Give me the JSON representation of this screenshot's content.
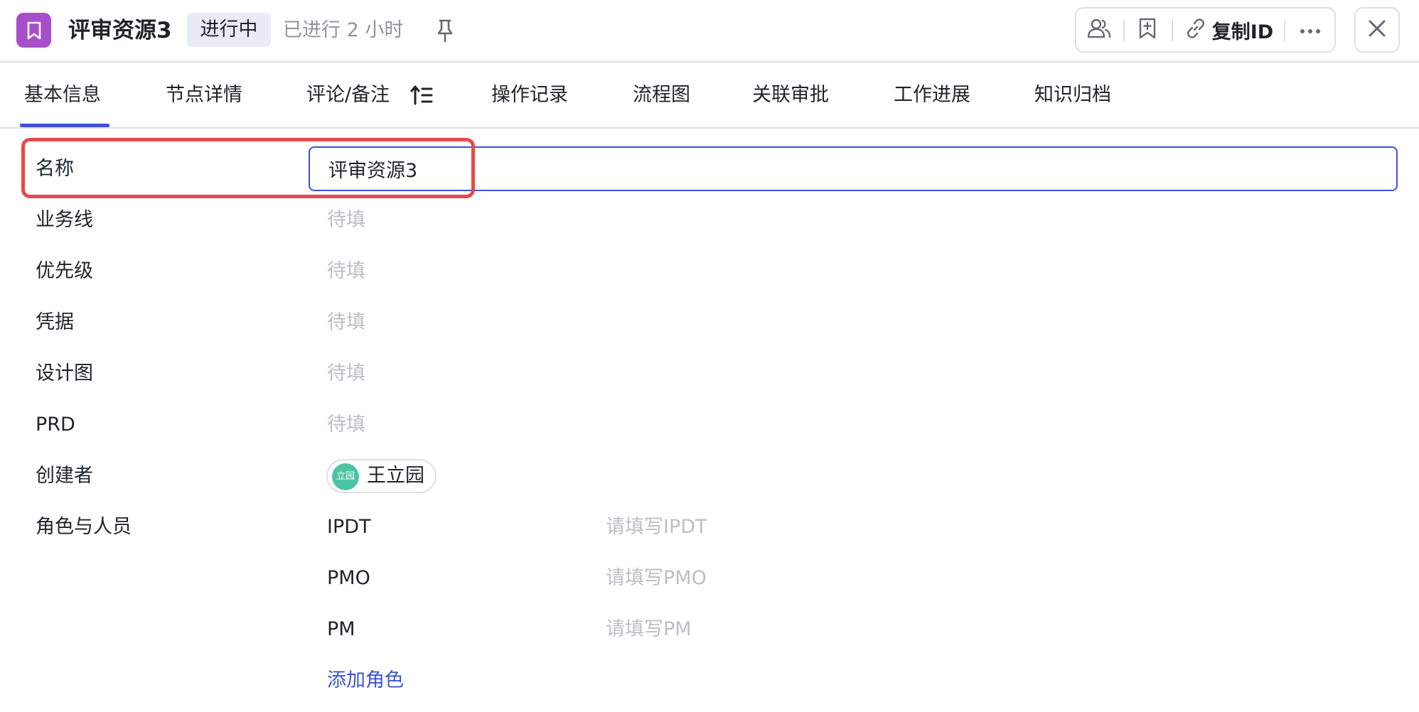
{
  "header": {
    "title": "评审资源3",
    "status": "进行中",
    "elapsed": "已进行 2 小时",
    "copy_id_label": "复制ID"
  },
  "colors": {
    "brand_icon": "#a74fca",
    "accent": "#3c53d6",
    "highlight": "#e84a4a",
    "avatar": "#4cc4a4"
  },
  "icons": [
    "bookmark-icon",
    "pin-icon",
    "people-icon",
    "bookmark-add-icon",
    "link-icon",
    "more-icon",
    "close-icon",
    "sort-icon"
  ],
  "tabs": [
    {
      "label": "基本信息",
      "active": true
    },
    {
      "label": "节点详情"
    },
    {
      "label": "评论/备注"
    },
    {
      "label": "操作记录"
    },
    {
      "label": "流程图"
    },
    {
      "label": "关联审批"
    },
    {
      "label": "工作进展"
    },
    {
      "label": "知识归档"
    }
  ],
  "form": {
    "name": {
      "label": "名称",
      "value": "评审资源3"
    },
    "business_line": {
      "label": "业务线",
      "placeholder": "待填"
    },
    "priority": {
      "label": "优先级",
      "placeholder": "待填"
    },
    "credentials": {
      "label": "凭据",
      "placeholder": "待填"
    },
    "design": {
      "label": "设计图",
      "placeholder": "待填"
    },
    "prd": {
      "label": "PRD",
      "placeholder": "待填"
    },
    "creator": {
      "label": "创建者",
      "avatar_text": "立园",
      "name": "王立园"
    },
    "roles": {
      "label": "角色与人员",
      "items": [
        {
          "name": "IPDT",
          "placeholder": "请填写IPDT"
        },
        {
          "name": "PMO",
          "placeholder": "请填写PMO"
        },
        {
          "name": "PM",
          "placeholder": "请填写PM"
        }
      ],
      "add_label": "添加角色"
    }
  }
}
